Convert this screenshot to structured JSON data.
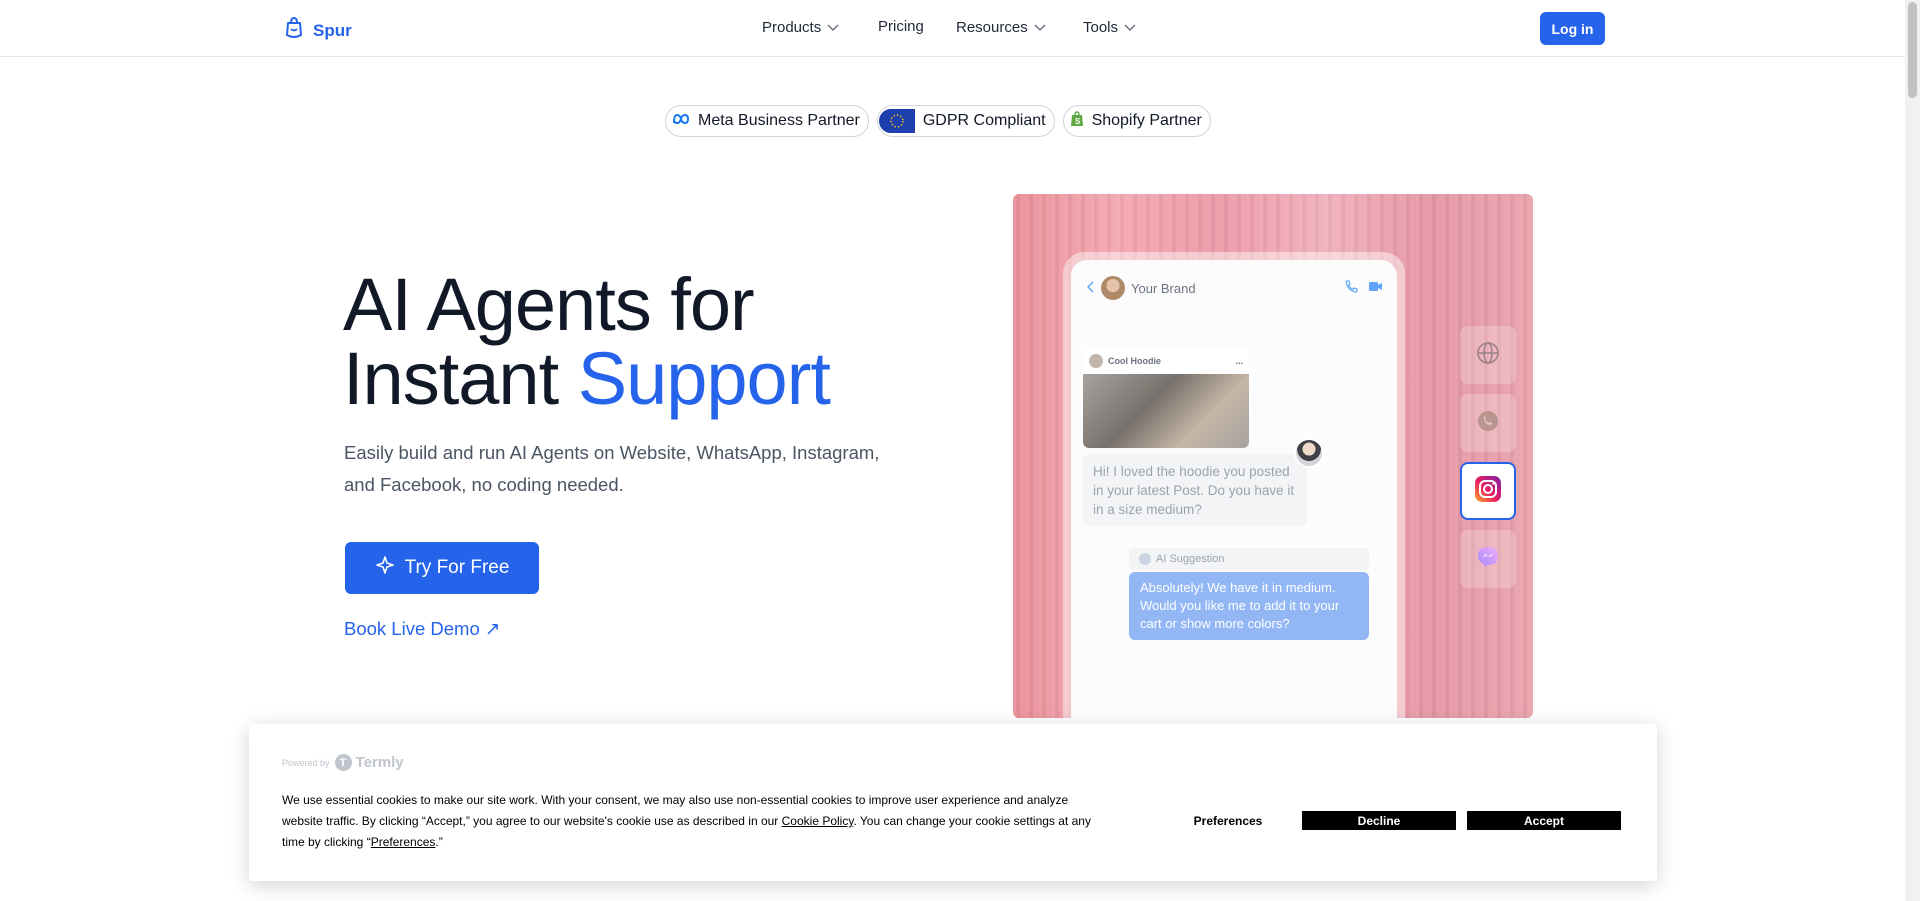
{
  "header": {
    "brand": "Spur",
    "nav": {
      "products": "Products",
      "pricing": "Pricing",
      "resources": "Resources",
      "tools": "Tools"
    },
    "login_label": "Log in"
  },
  "badges": {
    "meta": "Meta Business Partner",
    "gdpr": "GDPR Compliant",
    "shopify": "Shopify Partner"
  },
  "hero": {
    "title_line1": "AI Agents for",
    "title_line2_plain": "Instant ",
    "title_line2_accent": "Support",
    "subtitle": "Easily build and run AI Agents on Website, WhatsApp, Instagram, and Facebook, no coding needed.",
    "cta_label": "Try For Free",
    "demo_label": "Book Live Demo ↗"
  },
  "chat_mock": {
    "brand_name": "Your Brand",
    "post_title": "Cool Hoodie",
    "post_menu": "...",
    "user_message": "Hi! I loved the hoodie you posted in your latest Post. Do you have it in a size medium?",
    "ai_label": "AI Suggestion",
    "ai_message": "Absolutely! We have it in medium. Would you like me to add it to your cart or show more colors?",
    "channels": [
      "globe-icon",
      "whatsapp-icon",
      "instagram-icon",
      "messenger-icon"
    ],
    "active_channel": "instagram-icon"
  },
  "cookie_banner": {
    "powered_by": "Powered by",
    "provider": "Termly",
    "text_part1": "We use essential cookies to make our site work. With your consent, we may also use non-essential cookies to improve user experience and analyze website traffic. By clicking “Accept,” you agree to our website's cookie use as described in our ",
    "cookie_policy_link": "Cookie Policy",
    "text_part2": ". You can change your cookie settings at any time by clicking “",
    "preferences_link": "Preferences",
    "text_part3": ".”",
    "preferences_label": "Preferences",
    "decline_label": "Decline",
    "accept_label": "Accept"
  },
  "colors": {
    "brand_blue": "#2563eb",
    "text_dark": "#111827",
    "text_muted": "#4b5563"
  }
}
